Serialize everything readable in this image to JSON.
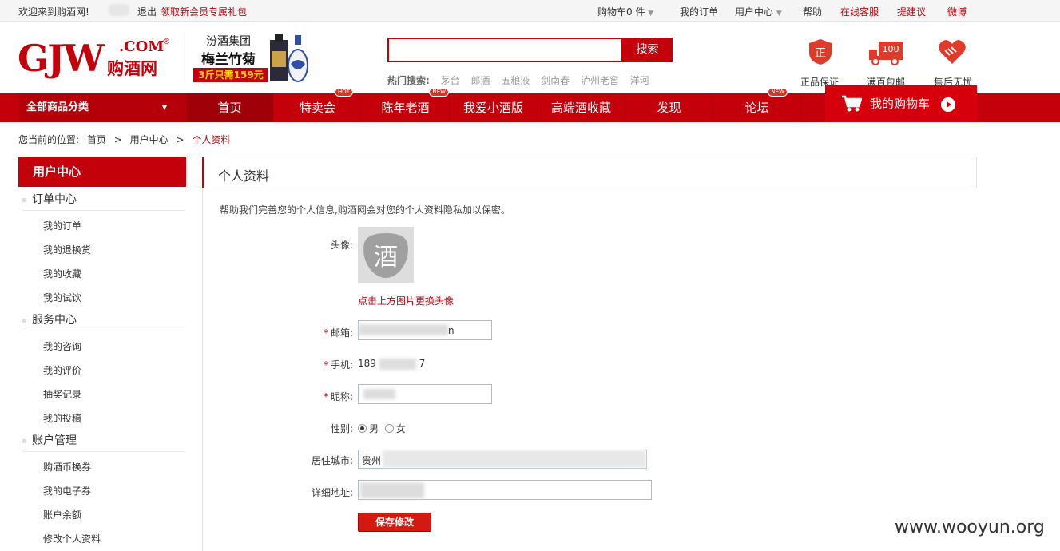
{
  "topbar": {
    "welcome": "欢迎来到购酒网!",
    "logout": "退出",
    "promo": "领取新会员专属礼包",
    "cart": "购物车0 件",
    "my_orders": "我的订单",
    "user_center": "用户中心",
    "help": "帮助",
    "online_service": "在线客服",
    "suggest": "提建议",
    "weibo": "微博"
  },
  "header": {
    "logo_text": "GJW",
    "logo_com": ".COM",
    "logo_cn": "购酒网",
    "logo_reg": "®",
    "ad_group": "汾酒集团",
    "ad_product": "梅兰竹菊",
    "ad_price": "3斤只需159元",
    "search_button": "搜索",
    "hot_label": "热门搜索:",
    "hot_terms": [
      "茅台",
      "郎酒",
      "五粮液",
      "剑南春",
      "泸州老窖",
      "洋河"
    ],
    "services": [
      "正品保证",
      "满百包邮",
      "售后无忧"
    ],
    "service_badge": "正",
    "service_truck": "100"
  },
  "nav": {
    "all_categories": "全部商品分类",
    "items": [
      {
        "label": "首页",
        "badge": ""
      },
      {
        "label": "特卖会",
        "badge": "HOT"
      },
      {
        "label": "陈年老酒",
        "badge": "NEW"
      },
      {
        "label": "我爱小酒版",
        "badge": ""
      },
      {
        "label": "高端酒收藏",
        "badge": ""
      },
      {
        "label": "发现",
        "badge": ""
      },
      {
        "label": "论坛",
        "badge": "NEW"
      }
    ],
    "cart": "我的购物车"
  },
  "breadcrumb": {
    "prefix": "您当前的位置:",
    "items": [
      "首页",
      ">",
      "用户中心",
      ">",
      "个人资料"
    ]
  },
  "sidebar": {
    "title": "用户中心",
    "sections": [
      {
        "label": "订单中心",
        "items": [
          "我的订单",
          "我的退换货",
          "我的收藏",
          "我的试饮"
        ]
      },
      {
        "label": "服务中心",
        "items": [
          "我的咨询",
          "我的评价",
          "抽奖记录",
          "我的投稿"
        ]
      },
      {
        "label": "账户管理",
        "items": [
          "购酒币换券",
          "我的电子券",
          "账户余额",
          "修改个人资料"
        ]
      }
    ]
  },
  "main": {
    "title": "个人资料",
    "description": "帮助我们完善您的个人信息,购酒网会对您的个人资料隐私加以保密。",
    "avatar_label": "头像:",
    "avatar_char": "酒",
    "avatar_hint": "点击上方图片更换头像",
    "email_label": "邮箱:",
    "email_value_tail": "n",
    "phone_label": "手机:",
    "phone_prefix": "189",
    "phone_suffix": "7",
    "nickname_label": "昵称:",
    "gender_label": "性别:",
    "gender_male": "男",
    "gender_female": "女",
    "city_label": "居住城市:",
    "city_value": "贵州",
    "address_label": "详细地址:",
    "save_button": "保存修改",
    "required_mark": "*"
  },
  "watermark": "www.wooyun.org",
  "colors": {
    "brand": "#c4000b",
    "field_border": "#a9bcd0"
  }
}
